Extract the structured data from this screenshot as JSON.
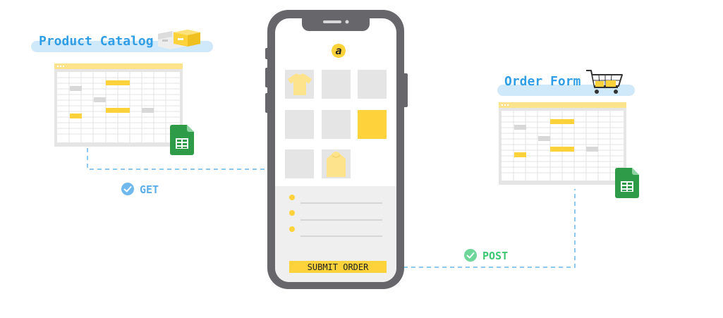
{
  "catalog": {
    "title": "Product Catalog"
  },
  "order_form": {
    "title": "Order Form"
  },
  "connections": {
    "get_label": "GET",
    "post_label": "POST"
  },
  "phone": {
    "logo_letter": "a",
    "submit_label": "SUBMIT ORDER"
  },
  "colors": {
    "accent_blue": "#2f9ee6",
    "pill_blue": "#cfe8fa",
    "dash_blue": "#8cc8f0",
    "yellow": "#fdd23a",
    "phone_frame": "#67676b",
    "sheet_grey": "#e5e5e5",
    "sheets_green": "#2e9b48",
    "post_green": "#3dc773"
  },
  "icons": [
    "google-sheets-icon",
    "boxes-icon",
    "shopping-cart-icon",
    "check-circle-icon",
    "tshirt-icon",
    "hoodie-icon",
    "logo-icon"
  ]
}
